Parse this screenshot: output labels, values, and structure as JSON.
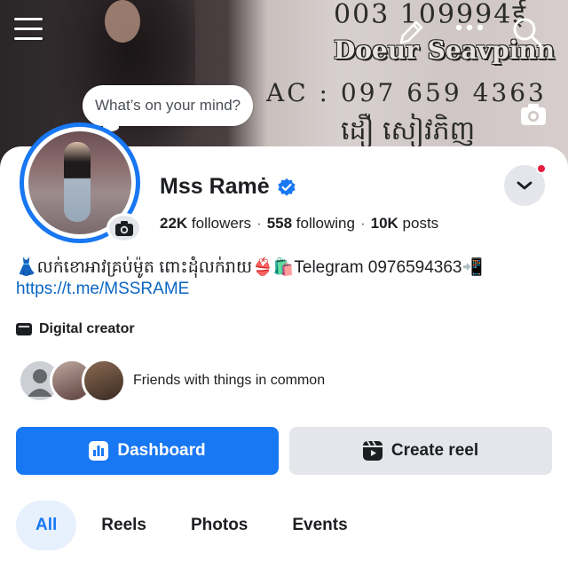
{
  "cover": {
    "line_top": "003 109994ई",
    "name_overlay": "Doeur Seavpinn",
    "line_ac": "AC : 097 659 4363",
    "line_khmer": "ដឿ សៀវភិញ"
  },
  "status_prompt": "What’s on your mind?",
  "profile": {
    "name": "Mss Ramė",
    "followers_count": "22K",
    "followers_label": "followers",
    "following_count": "558",
    "following_label": "following",
    "posts_count": "10K",
    "posts_label": "posts",
    "bio_line": "👗លក់ខោអាវគ្រប់ម៉ូត ពោះដុំលក់រាយ👙🛍️Telegram 0976594363📲",
    "bio_link": "https://t.me/MSSRAME",
    "category": "Digital creator",
    "friends_text": "Friends with things in common"
  },
  "buttons": {
    "dashboard": "Dashboard",
    "create_reel": "Create reel"
  },
  "tabs": [
    {
      "label": "All",
      "active": true
    },
    {
      "label": "Reels",
      "active": false
    },
    {
      "label": "Photos",
      "active": false
    },
    {
      "label": "Events",
      "active": false
    }
  ],
  "colors": {
    "accent": "#1877f2",
    "notification": "#e41e3f",
    "secondary_button": "#e4e6eb"
  }
}
